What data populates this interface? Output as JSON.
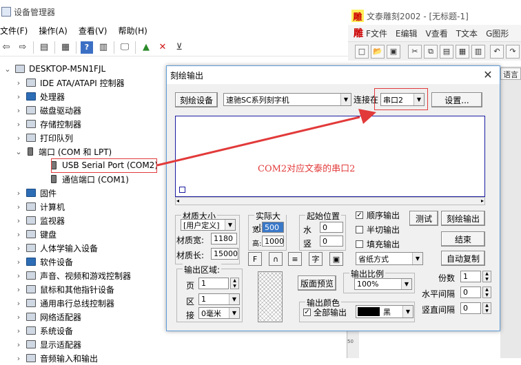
{
  "device_manager": {
    "title": "设备管理器",
    "menu": [
      "文件(F)",
      "操作(A)",
      "查看(V)",
      "帮助(H)"
    ],
    "root": "DESKTOP-M5N1FJL",
    "tree": [
      {
        "label": "IDE ATA/ATAPI 控制器",
        "icon": "ide-controller-icon"
      },
      {
        "label": "处理器",
        "icon": "processor-icon"
      },
      {
        "label": "磁盘驱动器",
        "icon": "disk-drive-icon"
      },
      {
        "label": "存储控制器",
        "icon": "storage-controller-icon"
      },
      {
        "label": "打印队列",
        "icon": "printer-icon"
      },
      {
        "label": "端口 (COM 和 LPT)",
        "icon": "port-icon",
        "expanded": true
      },
      {
        "label": "USB Serial Port (COM2)",
        "icon": "port-icon",
        "child": true
      },
      {
        "label": "通信端口 (COM1)",
        "icon": "port-icon",
        "child": true
      },
      {
        "label": "固件",
        "icon": "firmware-icon"
      },
      {
        "label": "计算机",
        "icon": "computer-icon"
      },
      {
        "label": "监视器",
        "icon": "monitor-icon"
      },
      {
        "label": "键盘",
        "icon": "keyboard-icon"
      },
      {
        "label": "人体学输入设备",
        "icon": "hid-icon"
      },
      {
        "label": "软件设备",
        "icon": "software-device-icon"
      },
      {
        "label": "声音、视频和游戏控制器",
        "icon": "sound-icon"
      },
      {
        "label": "鼠标和其他指针设备",
        "icon": "mouse-icon"
      },
      {
        "label": "通用串行总线控制器",
        "icon": "usb-icon"
      },
      {
        "label": "网络适配器",
        "icon": "network-icon"
      },
      {
        "label": "系统设备",
        "icon": "system-device-icon"
      },
      {
        "label": "显示适配器",
        "icon": "display-adapter-icon"
      },
      {
        "label": "音频输入和输出",
        "icon": "audio-icon"
      }
    ]
  },
  "wentai": {
    "title": "文泰雕刻2002 - [无标题-1]",
    "logo": "雕",
    "menu": [
      "F文件",
      "E编辑",
      "V查看",
      "T文本",
      "G图形"
    ],
    "side_tab": "语言"
  },
  "dialog": {
    "title": "刻绘输出",
    "device_button": "刻绘设备",
    "device_select": "速驰SC系列刻字机",
    "connect_label": "连接在",
    "port_select": "串口2",
    "settings_button": "设置...",
    "annotation": "COM2对应文泰的串口2",
    "material": {
      "legend": "材质大小",
      "select": "[用户定义]",
      "width_label": "材质宽:",
      "width": "1180",
      "length_label": "材质长:",
      "length": "15000"
    },
    "actual": {
      "legend": "实际大小",
      "w_label": "宽:",
      "w": "500",
      "h_label": "高:",
      "h": "1000"
    },
    "start": {
      "legend": "起始位置",
      "h_label": "水",
      "h": "0",
      "v_label": "竖",
      "v": "0"
    },
    "options": {
      "sequential": "顺序输出",
      "half_cut": "半切输出",
      "fill": "填充输出"
    },
    "paper_mode": "省纸方式",
    "test_button": "测试",
    "plot_button": "刻绘输出",
    "end_button": "结束",
    "auto_copy_button": "自动复制",
    "copies_label": "份数",
    "copies": "1",
    "h_gap_label": "水平间隔",
    "h_gap": "0",
    "v_gap_label": "竖直间隔",
    "v_gap": "0",
    "output_area": {
      "legend": "输出区域:",
      "page_label": "页",
      "page": "1",
      "area_label": "区",
      "area": "1",
      "join_label": "接",
      "join": "0毫米"
    },
    "layout_preview_button": "版面预览",
    "scale": {
      "legend": "输出比例",
      "value": "100%"
    },
    "color": {
      "legend": "输出颜色",
      "all_label": "全部输出",
      "color_name": "黑",
      "swatch": "#000000"
    }
  },
  "annotation_color": "#e23a3a"
}
